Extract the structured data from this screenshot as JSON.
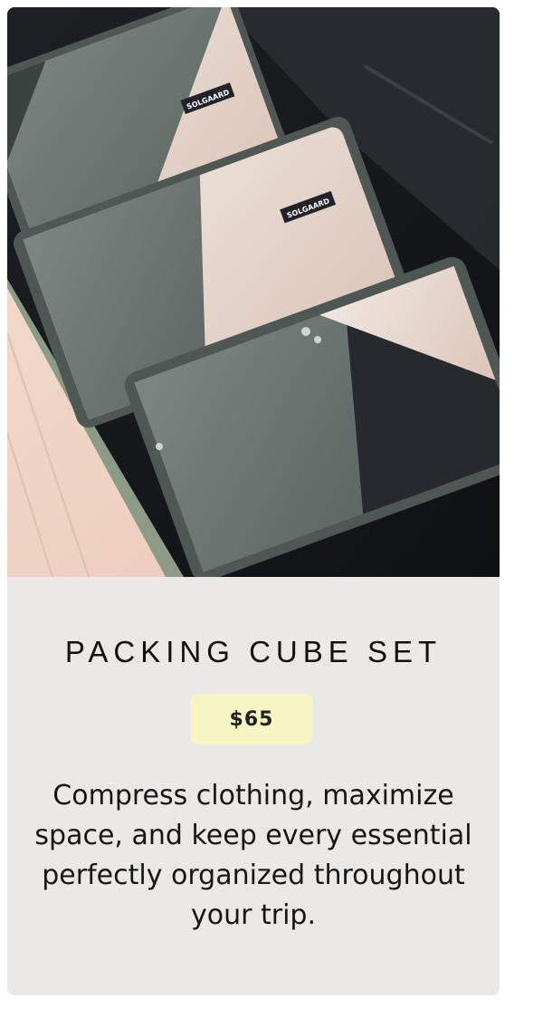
{
  "product": {
    "title": "PACKING CUBE SET",
    "price": "$65",
    "description": "Compress clothing, maximize space, and keep every essential perfectly organized throughout your trip.",
    "image_brand_label": "SOLGAARD"
  },
  "colors": {
    "card_background": "#ebe9e7",
    "price_badge": "#f7f6c2",
    "text": "#111111",
    "cube_gray": "#6b7470",
    "suitcase_frame": "#8d9a86",
    "floor": "#f0d6c6"
  }
}
